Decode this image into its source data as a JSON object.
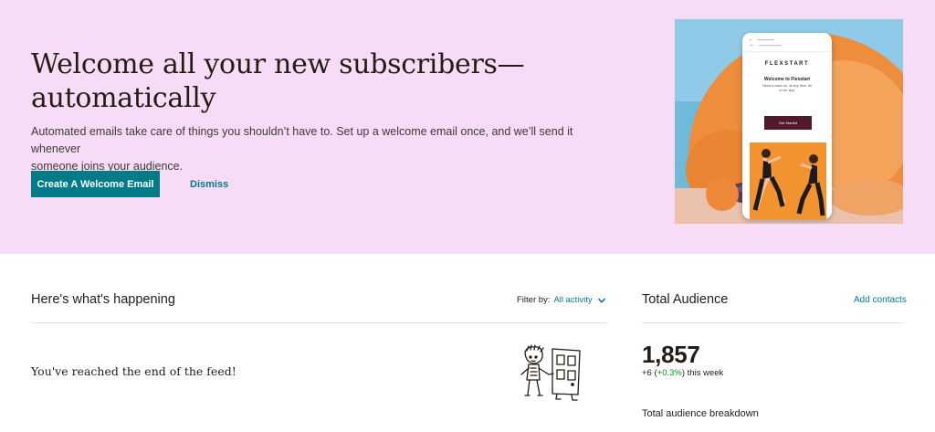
{
  "hero": {
    "title_line1": "Welcome all your new subscribers—",
    "title_line2": "automatically",
    "description_line1": "Automated emails take care of things you shouldn’t have to. Set up a welcome email once, and we’ll send it whenever",
    "description_line2": "someone joins your audience.",
    "cta_label": "Create A Welcome Email",
    "dismiss_label": "Dismiss",
    "preview": {
      "brand": "FLEXSTART",
      "heading": "Welcome to Flexstart",
      "copy": "Need a class on, at any time. All in our app.",
      "button_label": "Get Started"
    }
  },
  "feed": {
    "title": "Here's what's happening",
    "filter_label": "Filter by:",
    "filter_value": "All activity",
    "end_message": "You've reached the end of the feed!"
  },
  "audience": {
    "title": "Total Audience",
    "add_contacts_label": "Add contacts",
    "total": "1,857",
    "change_count": "+6",
    "change_percent": "+0.3%",
    "change_period": "this week",
    "breakdown_label": "Total audience breakdown"
  },
  "colors": {
    "hero_background": "#f6dcf7",
    "brand_teal": "#007c89",
    "positive_green": "#00892c",
    "preview_button": "#52192b",
    "text": "#241c15"
  },
  "icons": {
    "filter_toggle": "chevron-down-icon",
    "feed_end_art": "character-with-door-illustration"
  }
}
